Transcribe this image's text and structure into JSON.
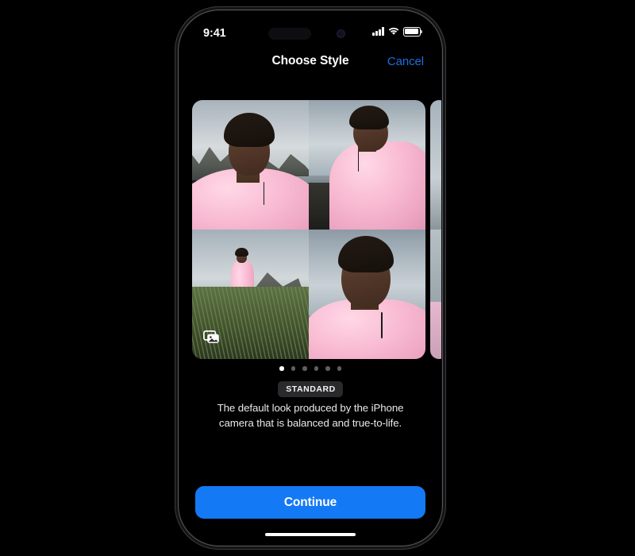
{
  "background_color": "#000000",
  "device": {
    "name": "iphone-frame",
    "bezel_color": "#5a5a5e",
    "screen_background": "#000000"
  },
  "status_bar": {
    "time": "9:41",
    "signal_icon": "cellular-signal-icon",
    "signal_bars": 4,
    "wifi_icon": "wifi-icon",
    "battery_icon": "battery-icon",
    "battery_level_percent": 85,
    "dynamic_island": "dynamic-island",
    "camera_dot": "front-camera-dot"
  },
  "nav_bar": {
    "title": "Choose Style",
    "cancel_label": "Cancel",
    "cancel_color": "#1a6fe0"
  },
  "carousel": {
    "photos_stack_icon": "photos-stack-icon",
    "cards": [
      {
        "style_id": "standard",
        "photo_count": 4,
        "photos": [
          "portrait-selfie-mountains",
          "portrait-standing-black-beach",
          "full-body-grass-mountain",
          "closeup-portrait-overcast-sky"
        ]
      },
      {
        "style_id": "next-style-peek",
        "photo_count": 0,
        "photos": []
      }
    ]
  },
  "pagination": {
    "total_pages": 6,
    "active_index": 0,
    "active_color": "#ffffff",
    "inactive_color": "#5e5e60"
  },
  "style_info": {
    "badge_label": "STANDARD",
    "badge_background": "#2a2a2c",
    "description": "The default look produced by the iPhone camera that is balanced and true-to-life."
  },
  "footer": {
    "continue_label": "Continue",
    "continue_color": "#1479f5",
    "home_indicator": "home-indicator"
  }
}
